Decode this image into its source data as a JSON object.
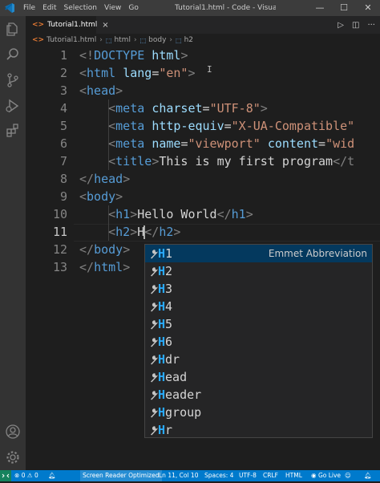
{
  "window": {
    "title": "Tutorial1.html - Code - Visua...",
    "menu": [
      "File",
      "Edit",
      "Selection",
      "View",
      "Go"
    ],
    "controls": {
      "minimize": "—",
      "maximize": "☐",
      "close": "✕"
    }
  },
  "tab": {
    "filename": "Tutorial1.html",
    "icon_text": "<>",
    "close": "×"
  },
  "tab_actions": {
    "run": "▷",
    "split": "◫",
    "more": "···"
  },
  "breadcrumb": [
    "Tutorial1.html",
    "html",
    "body",
    "h2"
  ],
  "editor": {
    "lines": [
      {
        "num": "1"
      },
      {
        "num": "2"
      },
      {
        "num": "3"
      },
      {
        "num": "4"
      },
      {
        "num": "5"
      },
      {
        "num": "6"
      },
      {
        "num": "7"
      },
      {
        "num": "8"
      },
      {
        "num": "9"
      },
      {
        "num": "10"
      },
      {
        "num": "11"
      },
      {
        "num": "12"
      },
      {
        "num": "13"
      }
    ],
    "tokens": {
      "l1_open": "<!",
      "l1_tag": "DOCTYPE",
      "l1_rest": " html",
      "l1_close": ">",
      "html": "html",
      "lang": "lang",
      "lang_val": "\"en\"",
      "head": "head",
      "meta": "meta",
      "charset": "charset",
      "charset_val": "\"UTF-8\"",
      "http_equiv": "http-equiv",
      "http_equiv_val": "\"X-UA-Compatible\"",
      "name": "name",
      "name_val": "\"viewport\"",
      "content": "content",
      "content_val": "\"wid",
      "title": "title",
      "title_text": "This is my first program",
      "title_close": "</t",
      "body": "body",
      "h1": "h1",
      "h1_text": "Hello World",
      "h2": "h2",
      "h2_text": "H",
      "lt": "<",
      "gt": ">",
      "lt_slash": "</",
      "eq": "="
    }
  },
  "suggest": {
    "items": [
      {
        "first": "H",
        "rest": "1",
        "detail": "Emmet Abbreviation"
      },
      {
        "first": "H",
        "rest": "2",
        "detail": ""
      },
      {
        "first": "H",
        "rest": "3",
        "detail": ""
      },
      {
        "first": "H",
        "rest": "4",
        "detail": ""
      },
      {
        "first": "H",
        "rest": "5",
        "detail": ""
      },
      {
        "first": "H",
        "rest": "6",
        "detail": ""
      },
      {
        "first": "H",
        "rest": "dr",
        "detail": ""
      },
      {
        "first": "H",
        "rest": "ead",
        "detail": ""
      },
      {
        "first": "H",
        "rest": "eader",
        "detail": ""
      },
      {
        "first": "H",
        "rest": "group",
        "detail": ""
      },
      {
        "first": "H",
        "rest": "r",
        "detail": ""
      }
    ]
  },
  "statusbar": {
    "errors": "0",
    "warnings": "0",
    "screen_reader": "Screen Reader Optimized",
    "position": "Ln 11, Col 10",
    "spaces": "Spaces: 4",
    "encoding": "UTF-8",
    "eol": "CRLF",
    "language": "HTML",
    "go_live": "Go Live"
  },
  "colors": {
    "accent": "#007acc",
    "tag": "#569cd6",
    "attribute": "#9cdcfe",
    "string": "#ce9178",
    "match_highlight": "#2aaaff",
    "selection": "#04395e"
  },
  "icons": {
    "app": "vscode-logo-icon",
    "activity": [
      "explorer-icon",
      "search-icon",
      "source-control-icon",
      "run-debug-icon",
      "extensions-icon",
      "account-icon",
      "manage-gear-icon"
    ]
  }
}
